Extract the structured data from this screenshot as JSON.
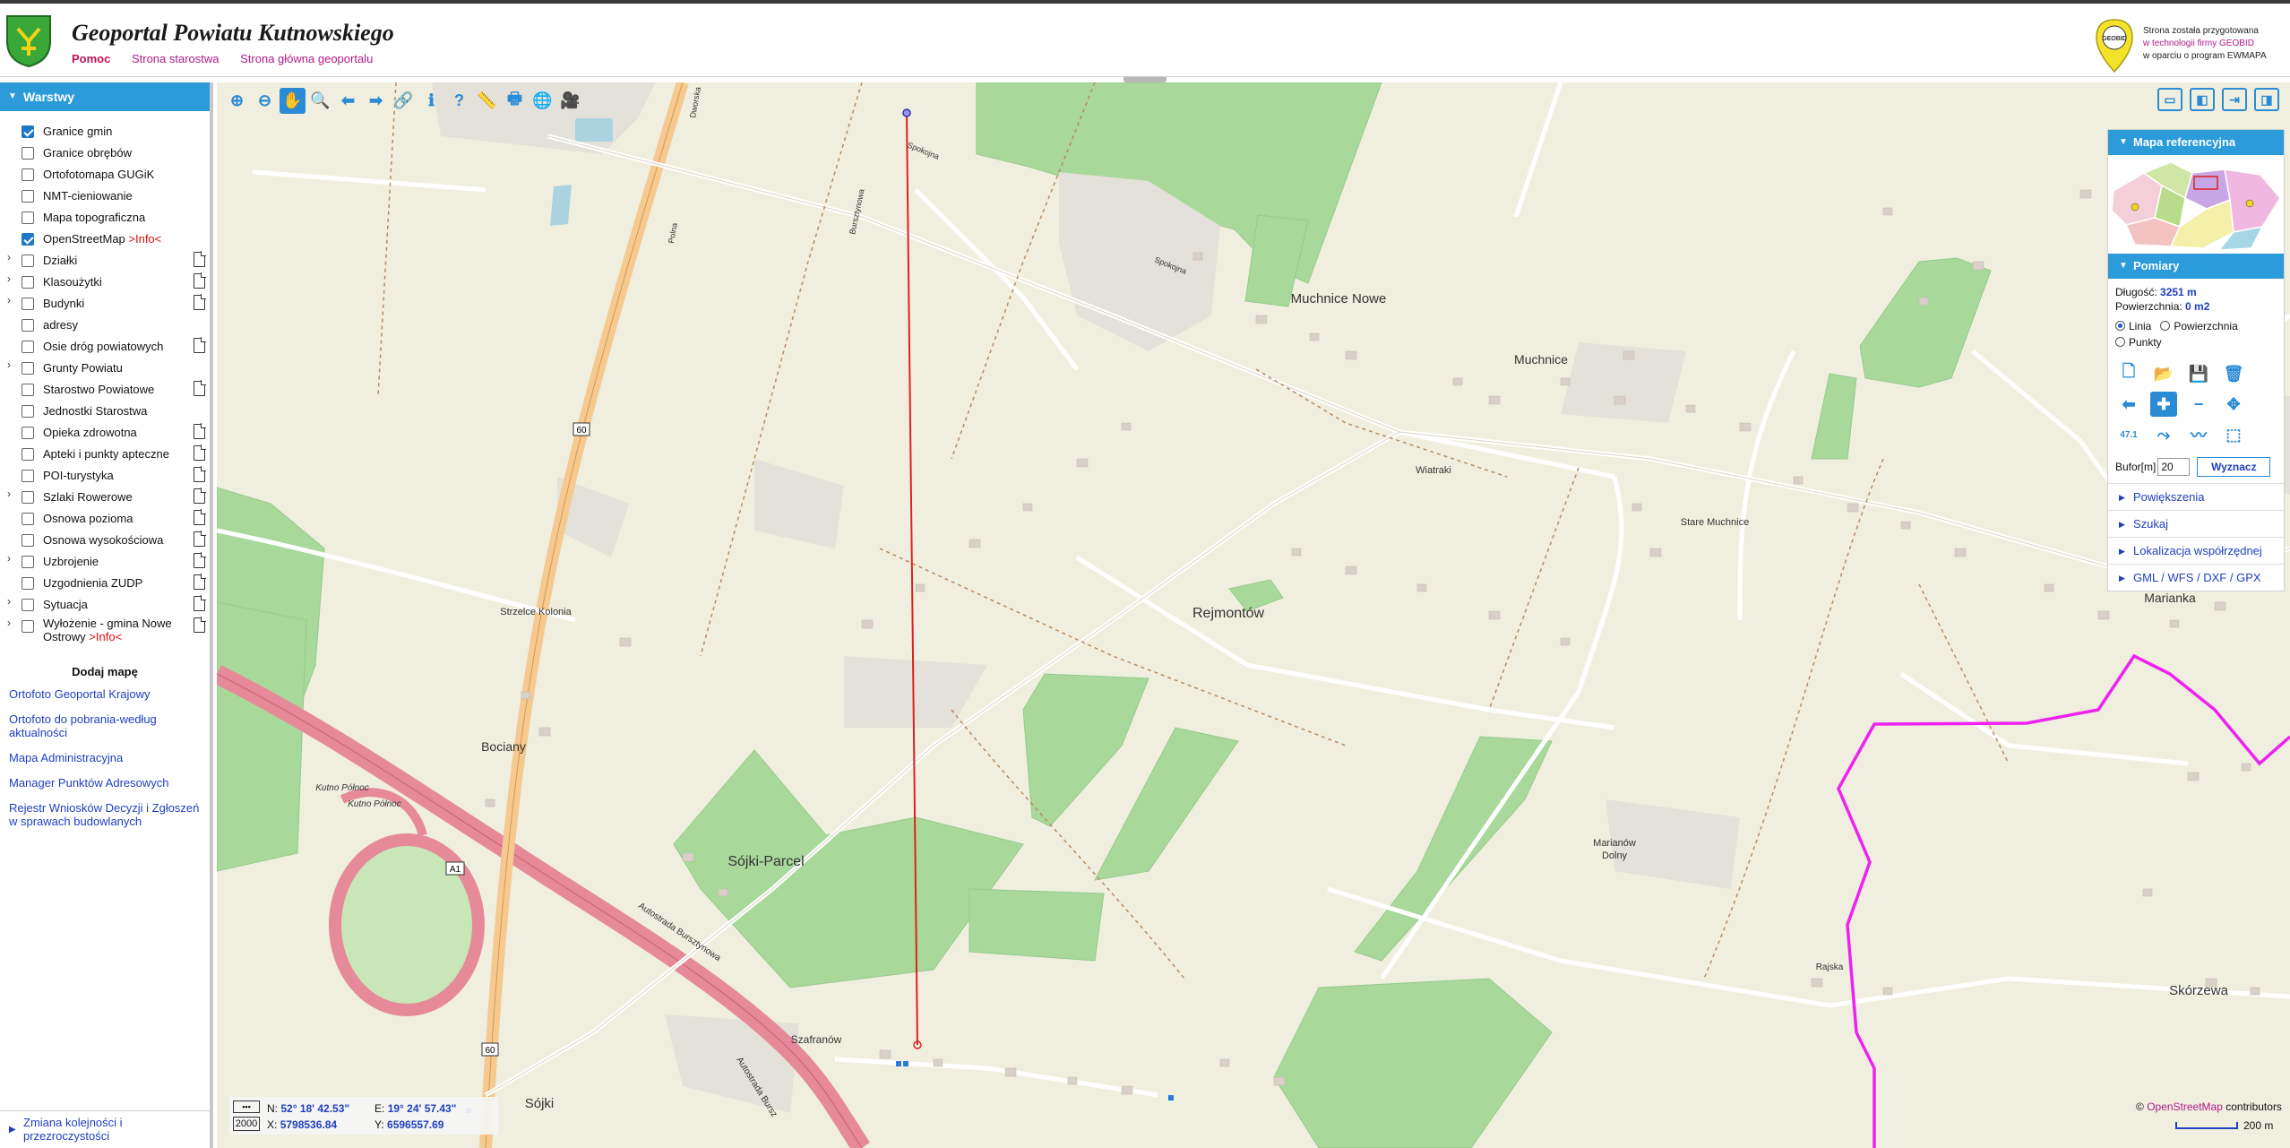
{
  "header": {
    "title": "Geoportal Powiatu Kutnowskiego",
    "links": [
      "Pomoc",
      "Strona starostwa",
      "Strona główna geoportalu"
    ],
    "geobid_text": [
      "Strona została przygotowana",
      "w technologii firmy GEOBID",
      "w oparciu o program EWMAPA"
    ],
    "geobid_logo_text": "GEOBID"
  },
  "layers_panel": {
    "title": "Warstwy",
    "layers": [
      {
        "label": "Granice gmin",
        "checked": true,
        "expandable": false,
        "doc": false,
        "info": ""
      },
      {
        "label": "Granice obrębów",
        "checked": false,
        "expandable": false,
        "doc": false,
        "info": ""
      },
      {
        "label": "Ortofotomapa GUGiK",
        "checked": false,
        "expandable": false,
        "doc": false,
        "info": ""
      },
      {
        "label": "NMT-cieniowanie",
        "checked": false,
        "expandable": false,
        "doc": false,
        "info": ""
      },
      {
        "label": "Mapa topograficzna",
        "checked": false,
        "expandable": false,
        "doc": false,
        "info": ""
      },
      {
        "label": "OpenStreetMap ",
        "checked": true,
        "expandable": false,
        "doc": false,
        "info": ">Info<"
      },
      {
        "label": "Działki",
        "checked": false,
        "expandable": true,
        "doc": true,
        "info": ""
      },
      {
        "label": "Klasoużytki",
        "checked": false,
        "expandable": true,
        "doc": true,
        "info": ""
      },
      {
        "label": "Budynki",
        "checked": false,
        "expandable": true,
        "doc": true,
        "info": ""
      },
      {
        "label": "adresy",
        "checked": false,
        "expandable": false,
        "doc": false,
        "info": ""
      },
      {
        "label": "Osie dróg powiatowych",
        "checked": false,
        "expandable": false,
        "doc": true,
        "info": ""
      },
      {
        "label": "Grunty Powiatu",
        "checked": false,
        "expandable": true,
        "doc": false,
        "info": ""
      },
      {
        "label": "Starostwo Powiatowe",
        "checked": false,
        "expandable": false,
        "doc": true,
        "info": ""
      },
      {
        "label": "Jednostki Starostwa",
        "checked": false,
        "expandable": false,
        "doc": false,
        "info": ""
      },
      {
        "label": "Opieka zdrowotna",
        "checked": false,
        "expandable": false,
        "doc": true,
        "info": ""
      },
      {
        "label": "Apteki i punkty apteczne",
        "checked": false,
        "expandable": false,
        "doc": true,
        "info": ""
      },
      {
        "label": "POI-turystyka",
        "checked": false,
        "expandable": false,
        "doc": true,
        "info": ""
      },
      {
        "label": "Szlaki Rowerowe",
        "checked": false,
        "expandable": true,
        "doc": true,
        "info": ""
      },
      {
        "label": "Osnowa pozioma",
        "checked": false,
        "expandable": false,
        "doc": true,
        "info": ""
      },
      {
        "label": "Osnowa wysokościowa",
        "checked": false,
        "expandable": false,
        "doc": true,
        "info": ""
      },
      {
        "label": "Uzbrojenie",
        "checked": false,
        "expandable": true,
        "doc": true,
        "info": ""
      },
      {
        "label": "Uzgodnienia ZUDP",
        "checked": false,
        "expandable": false,
        "doc": true,
        "info": ""
      },
      {
        "label": "Sytuacja",
        "checked": false,
        "expandable": true,
        "doc": true,
        "info": ""
      },
      {
        "label": "Wyłożenie - gmina Nowe Ostrowy ",
        "checked": false,
        "expandable": true,
        "doc": true,
        "info": ">Info<"
      }
    ],
    "add_map_title": "Dodaj mapę",
    "add_map_links": [
      "Ortofoto Geoportal Krajowy",
      "Ortofoto do pobrania-według aktualności",
      "Mapa Administracyjna",
      "Manager Punktów Adresowych",
      "Rejestr Wniosków Decyzji i Zgłoszeń w sprawach budowlanych"
    ],
    "layer_order_link": "Zmiana kolejności i przezroczystości"
  },
  "toolbar": {
    "tools": [
      "zoom-in-icon",
      "zoom-out-icon",
      "pan-hand-icon",
      "zoom-box-icon",
      "back-arrow-icon",
      "forward-arrow-icon",
      "link-icon",
      "info-icon",
      "query-icon",
      "measure-ruler-icon",
      "print-icon",
      "globe-icon",
      "camera-icon"
    ],
    "right_tools": [
      "layout-top-icon",
      "layout-left-icon",
      "export-arrow-icon",
      "layout-right-icon"
    ]
  },
  "right_panel": {
    "refmap_title": "Mapa referencyjna",
    "measure_title": "Pomiary",
    "length_label": "Długość:",
    "length_value": "3251 m",
    "area_label": "Powierzchnia:",
    "area_value": "0 m2",
    "mode_options": [
      "Linia",
      "Powierzchnia",
      "Punkty"
    ],
    "mode_selected": "Linia",
    "buffer_label": "Bufor[m]",
    "buffer_value": "20",
    "compute_button": "Wyznacz",
    "angle_label": "47.1",
    "sections": [
      "Powiększenia",
      "Szukaj",
      "Lokalizacja współrzędnej",
      "GML / WFS / DXF / GPX"
    ]
  },
  "coords": {
    "scale_label": "2000",
    "n_label": "N:",
    "n_value": "52° 18' 42.53\"",
    "e_label": "E:",
    "e_value": "19° 24' 57.43\"",
    "x_label": "X:",
    "x_value": "5798536.84",
    "y_label": "Y:",
    "y_value": "6596557.69"
  },
  "attribution": {
    "prefix": "© ",
    "osm": "OpenStreetMap",
    "suffix": " contributors"
  },
  "scale_bar": {
    "label": "200 m"
  },
  "map_labels": {
    "muchnice_nowe": "Muchnice Nowe",
    "muchnice": "Muchnice",
    "wiatraki": "Wiatraki",
    "stare_muchnice": "Stare Muchnice",
    "rejmontow": "Rejmontów",
    "strzelce_kolonia": "Strzelce Kolonia",
    "bociany": "Bociany",
    "sojki_parcel": "Sójki-Parcel",
    "szafranow": "Szafranów",
    "sojki": "Sójki",
    "marianow_dolny_1": "Marianów",
    "marianow_dolny_2": "Dolny",
    "marianka": "Marianka",
    "skorzewa": "Skórzewa",
    "kutno_polnoc_1": "Kutno Północ",
    "kutno_polnoc_2": "Kutno Północ",
    "autostrada": "Autostrada Bursztynowa",
    "autostrada_2": "Autostrada Bursz",
    "a1": "A1",
    "road_60_a": "60",
    "road_60_b": "60",
    "spokojna": "Spokojna",
    "spokojna_2": "Spokojna",
    "polna": "Polna",
    "dworska": "Dworska",
    "rajska": "Rajska",
    "bursztynowa_road": "Bursztynowa"
  },
  "colors": {
    "accent": "#2b9bd9",
    "link": "#1f3fc0",
    "map_bg": "#f0efdf",
    "forest": "#a8d99a",
    "boundary": "#ee22ee",
    "measure_line": "#e02020",
    "motorway": "#e68a9a",
    "trunk": "#f5c98f"
  }
}
